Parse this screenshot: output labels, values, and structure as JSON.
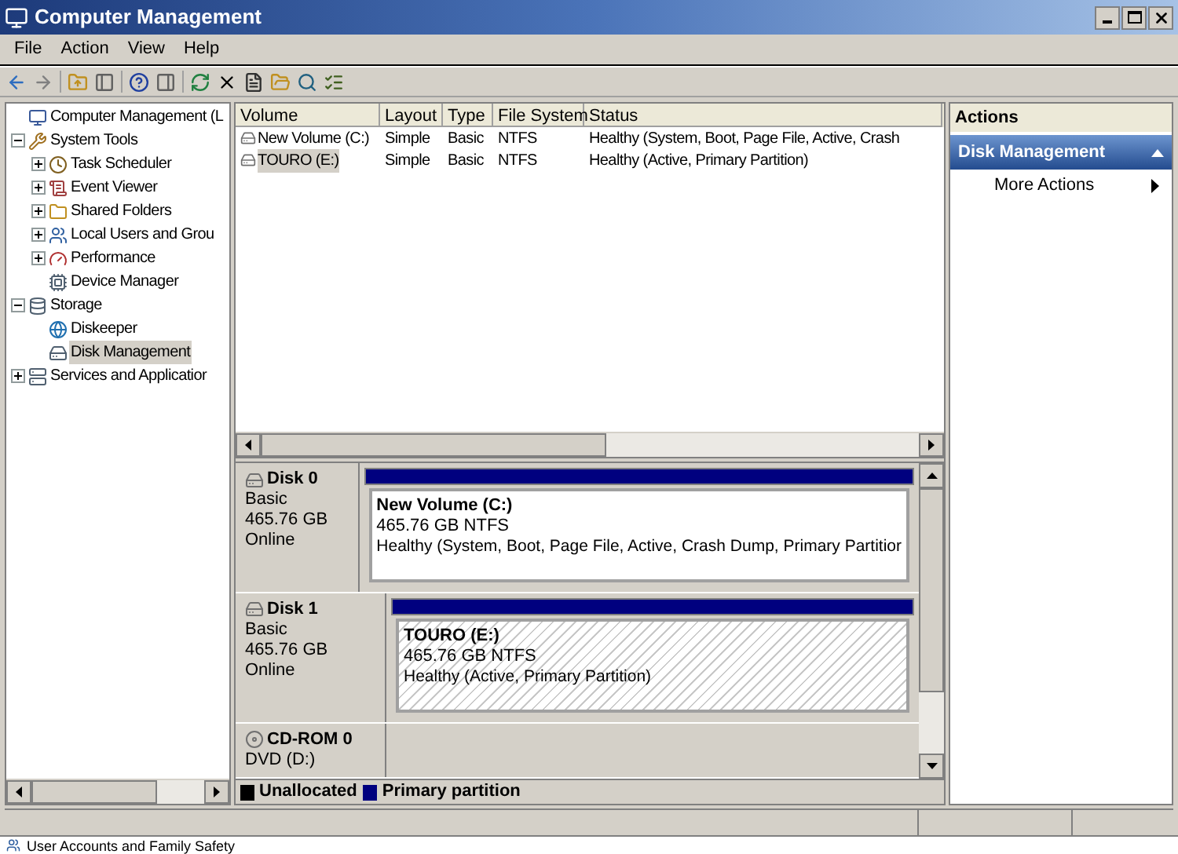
{
  "window": {
    "title": "Computer Management"
  },
  "menu": [
    "File",
    "Action",
    "View",
    "Help"
  ],
  "tree": [
    {
      "label": "Computer Management (L",
      "selected": false,
      "children": [
        {
          "label": "System Tools",
          "expanded": true,
          "selected": false,
          "children": [
            {
              "label": "Task Scheduler",
              "expanded": false,
              "selected": false
            },
            {
              "label": "Event Viewer",
              "expanded": false,
              "selected": false
            },
            {
              "label": "Shared Folders",
              "expanded": false,
              "selected": false
            },
            {
              "label": "Local Users and Grou",
              "expanded": false,
              "selected": false
            },
            {
              "label": "Performance",
              "expanded": false,
              "selected": false
            },
            {
              "label": "Device Manager",
              "selected": false
            }
          ]
        },
        {
          "label": "Storage",
          "expanded": true,
          "selected": false,
          "children": [
            {
              "label": "Diskeeper",
              "selected": false
            },
            {
              "label": "Disk Management",
              "selected": true
            }
          ]
        },
        {
          "label": "Services and Applicatior",
          "expanded": false,
          "selected": false
        }
      ]
    }
  ],
  "volumes": {
    "columns": [
      "Volume",
      "Layout",
      "Type",
      "File System",
      "Status"
    ],
    "rows": [
      {
        "cells": [
          "New Volume (C:)",
          "Simple",
          "Basic",
          "NTFS",
          "Healthy (System, Boot, Page File, Active, Crash"
        ],
        "selected": false
      },
      {
        "cells": [
          "TOURO (E:)",
          "Simple",
          "Basic",
          "NTFS",
          "Healthy (Active, Primary Partition)"
        ],
        "selected": true
      }
    ]
  },
  "disks": [
    {
      "kind": "disk",
      "name": "Disk 0",
      "lines": [
        "Basic",
        "465.76 GB",
        "Online"
      ],
      "partition": {
        "name": "New Volume  (C:)",
        "size": "465.76 GB NTFS",
        "status": "Healthy (System, Boot, Page File, Active, Crash Dump, Primary Partitior",
        "selected": false
      }
    },
    {
      "kind": "disk",
      "name": "Disk 1",
      "lines": [
        "Basic",
        "465.76 GB",
        "Online"
      ],
      "partition": {
        "name": "TOURO  (E:)",
        "size": "465.76 GB NTFS",
        "status": "Healthy (Active, Primary Partition)",
        "selected": true
      }
    },
    {
      "kind": "cdrom",
      "name": "CD-ROM 0",
      "lines": [
        "DVD (D:)"
      ]
    }
  ],
  "legend": [
    {
      "label": "Unallocated",
      "color": "#000000"
    },
    {
      "label": "Primary partition",
      "color": "#00007f"
    }
  ],
  "actions": {
    "title": "Actions",
    "section": "Disk Management",
    "items": [
      "More Actions"
    ]
  },
  "background_window": {
    "text": "User Accounts and Family Safety"
  }
}
